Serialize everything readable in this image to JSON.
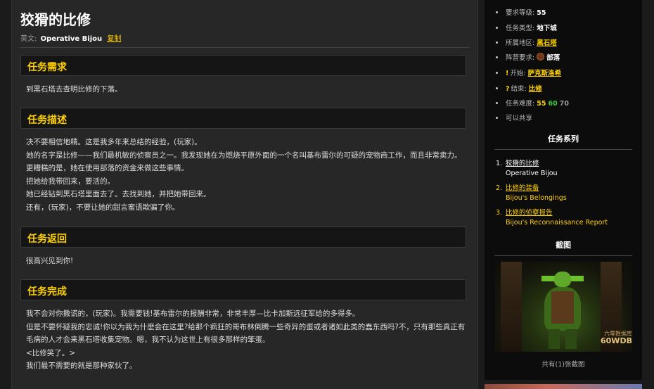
{
  "quest": {
    "title": "狡猾的比修",
    "en_prefix": "英文:",
    "en_name": "Operative Bijou",
    "copy_label": "复制"
  },
  "sections": {
    "requirements": {
      "heading": "任务需求",
      "lines": [
        "到黑石塔去查明比修的下落。"
      ]
    },
    "description": {
      "heading": "任务描述",
      "lines": [
        "决不要相信地精。这是我多年来总结的经验，(玩家)。",
        "她的名字是比修——我们最机敏的侦察员之一。我发现她在为燃烧平原外面的一个名叫基布雷尔的可疑的宠物商工作，而且非常卖力。",
        "更糟糕的是，她在使用部落的资金来做这些事情。",
        "把她给我带回来，要活的。",
        "她已经钻到黑石塔里面去了。去找到她，并把她带回来。",
        "还有，(玩家)，不要让她的甜言蜜语欺骗了你。"
      ]
    },
    "progress": {
      "heading": "任务返回",
      "lines": [
        "很高兴见到你!"
      ]
    },
    "completion": {
      "heading": "任务完成",
      "lines": [
        "我不会对你撒谎的，(玩家)。我需要钱!基布雷尔的报酬非常，非常丰厚—比卡加斯远征军给的多得多。",
        "但是不要怀疑我的忠诚!你以为我为什麽会在这里?给那个疯狂的哥布林倒腾一些奇异的蛋或者诸如此类的蠢东西吗?不，只有那些真正有",
        "毛病的人才会来黑石塔收集宠物。嗯，我不认为这世上有很多那样的笨蛋。",
        "<比修笑了。>",
        "我们最不需要的就是那种家伙了。"
      ]
    }
  },
  "info": {
    "level_label": "要求等级:",
    "level_value": "55",
    "type_label": "任务类型:",
    "type_value": "地下城",
    "zone_label": "所属地区:",
    "zone_value": "黑石塔",
    "faction_label": "阵营要求:",
    "faction_value": "部落",
    "start_label": "开始:",
    "start_value": "萨克斯洛希",
    "end_label": "结束:",
    "end_value": "比修",
    "difficulty_label": "任务难度:",
    "difficulty_values": [
      "55",
      "60",
      "70"
    ],
    "shareable": "可以共享"
  },
  "series": {
    "heading": "任务系列",
    "items": [
      {
        "num": "1.",
        "cn": "狡猾的比修",
        "en": "Operative Bijou"
      },
      {
        "num": "2.",
        "cn": "比修的装备",
        "en": "Bijou's Belongings"
      },
      {
        "num": "3.",
        "cn": "比修的侦察报告",
        "en": "Bijou's Reconnaissance Report"
      }
    ]
  },
  "screenshots": {
    "heading": "截图",
    "watermark_top": "六零数据库",
    "watermark_bottom": "60WDB",
    "caption": "共有(1)张截图"
  },
  "colors": {
    "accent": "#ffd100",
    "difficulty_green": "#3ec93e",
    "difficulty_gray": "#9a9a9a"
  }
}
